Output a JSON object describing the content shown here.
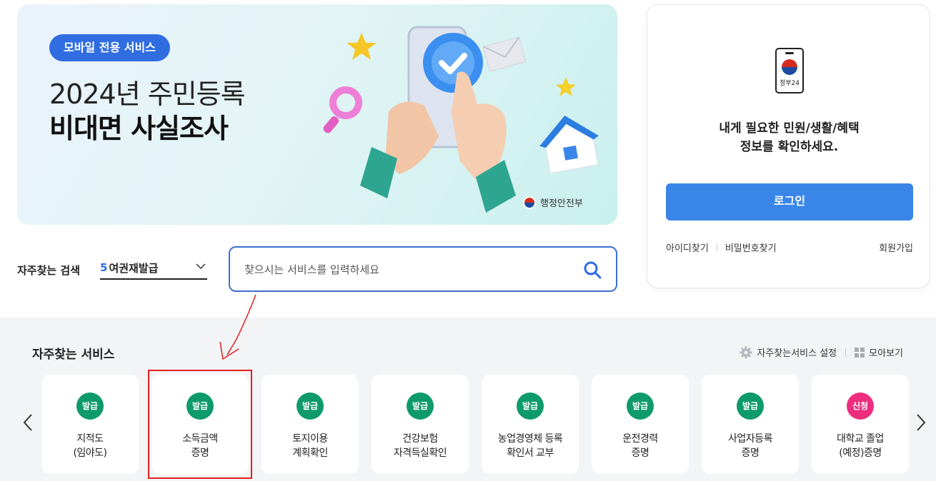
{
  "banner": {
    "badge": "모바일 전용 서비스",
    "title_line1": "2024년 주민등록",
    "title_line2": "비대면 사실조사",
    "ministry": "행정안전부"
  },
  "login": {
    "app_label": "정부24",
    "message_line1": "내게 필요한 민원/생활/혜택",
    "message_line2": "정보를 확인하세요.",
    "login_button": "로그인",
    "find_id": "아이디찾기",
    "find_password": "비밀번호찾기",
    "signup": "회원가입"
  },
  "search": {
    "fav_label": "자주찾는 검색",
    "fav_rank": "5",
    "fav_value": "여권재발급",
    "placeholder": "찾으시는 서비스를 입력하세요"
  },
  "services": {
    "title": "자주찾는 서비스",
    "settings_label": "자주찾는서비스 설정",
    "view_all_label": "모아보기",
    "cards": [
      {
        "tag": "발급",
        "line1": "지적도",
        "line2": "(임야도)",
        "tag_color": "#0e9a6b"
      },
      {
        "tag": "발급",
        "line1": "소득금액",
        "line2": "증명",
        "tag_color": "#0e9a6b"
      },
      {
        "tag": "발급",
        "line1": "토지이용",
        "line2": "계획확인",
        "tag_color": "#0e9a6b"
      },
      {
        "tag": "발급",
        "line1": "건강보험",
        "line2": "자격득실확인",
        "tag_color": "#0e9a6b"
      },
      {
        "tag": "발급",
        "line1": "농업경영체 등록",
        "line2": "확인서 교부",
        "tag_color": "#0e9a6b"
      },
      {
        "tag": "발급",
        "line1": "운전경력",
        "line2": "증명",
        "tag_color": "#0e9a6b"
      },
      {
        "tag": "발급",
        "line1": "사업자등록",
        "line2": "증명",
        "tag_color": "#0e9a6b"
      },
      {
        "tag": "신청",
        "line1": "대학교 졸업",
        "line2": "(예정)증명",
        "tag_color": "#ee2d7f"
      }
    ]
  },
  "colors": {
    "primary": "#3a86e8",
    "badge": "#2f6de0",
    "issue_tag": "#0e9a6b",
    "apply_tag": "#ee2d7f",
    "annotation": "#e01f1f"
  }
}
